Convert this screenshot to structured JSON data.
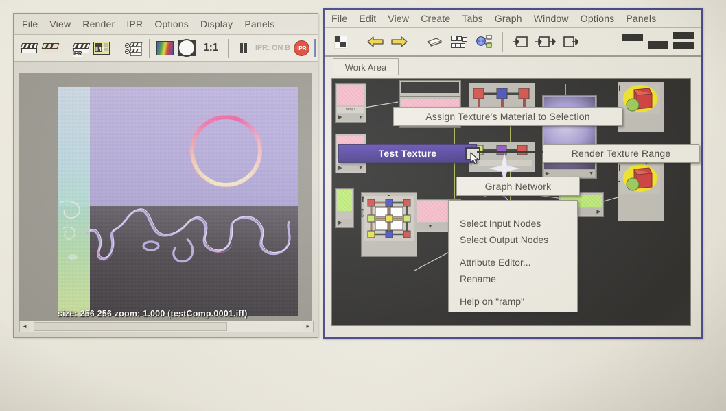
{
  "render_window": {
    "menus": [
      "File",
      "View",
      "Render",
      "IPR",
      "Options",
      "Display",
      "Panels"
    ],
    "toolbar": [
      {
        "name": "render-clapper-icon",
        "label": ""
      },
      {
        "name": "render-region-clapper-icon",
        "label": ""
      },
      {
        "name": "ipr-clapper-icon",
        "label": "IPR"
      },
      {
        "name": "ipr-box-icon",
        "label": "IPR"
      },
      {
        "name": "ipr-options-icon",
        "label": ""
      },
      {
        "name": "color-channel-icon",
        "label": ""
      },
      {
        "name": "alpha-channel-icon",
        "label": ""
      },
      {
        "name": "zoom-one-to-one-button",
        "label": "1:1"
      },
      {
        "name": "pause-ipr-icon",
        "label": ""
      },
      {
        "name": "ipr-status-label",
        "label": "IPR: ON B"
      },
      {
        "name": "stop-ipr-icon",
        "label": "IPR"
      }
    ],
    "status": {
      "text": "size:  256  256 zoom: 1.000   (testComp.0001.iff)",
      "size_label": "size:",
      "width": "256",
      "height": "256",
      "zoom_label": "zoom:",
      "zoom_value": "1.000",
      "file": "(testComp.0001.iff)"
    },
    "scrollbar": {
      "left_arrow": "◄",
      "right_arrow": "►"
    }
  },
  "hypershade_window": {
    "menus": [
      "File",
      "Edit",
      "View",
      "Create",
      "Tabs",
      "Graph",
      "Window",
      "Options",
      "Panels"
    ],
    "toolbar": [
      {
        "name": "checker-swatch-icon"
      },
      {
        "name": "back-arrow-icon"
      },
      {
        "name": "forward-arrow-icon"
      },
      {
        "name": "clear-graph-icon"
      },
      {
        "name": "rearrange-graph-icon"
      },
      {
        "name": "show-network-icon"
      },
      {
        "name": "input-connections-icon"
      },
      {
        "name": "input-output-connections-icon"
      },
      {
        "name": "output-connections-icon"
      }
    ],
    "tabs": [
      {
        "label": "Work Area",
        "active": true
      }
    ],
    "graph": {
      "node_caption": "ramp1",
      "nodes": [
        {
          "name": "ramp-node",
          "kind": "pink"
        },
        {
          "name": "ramp-node",
          "kind": "pink"
        },
        {
          "name": "ramp-node",
          "kind": "pink"
        },
        {
          "name": "ramp-node",
          "kind": "green"
        },
        {
          "name": "shading-group-node",
          "kind": "shaderball"
        },
        {
          "name": "place2d-texture-node",
          "kind": "placement"
        }
      ]
    }
  },
  "context_menus": {
    "assign_texture": "Assign Texture's Material to Selection",
    "render_texture_range": "Render Texture Range",
    "test_texture": "Test Texture",
    "graph_network": "Graph Network",
    "node_menu": [
      "Select Input Nodes",
      "Select Output Nodes",
      "Attribute Editor...",
      "Rename",
      "Help on \"ramp\""
    ]
  },
  "colors": {
    "highlight": "#35238b",
    "window_border": "#2a2a7e",
    "panel_bg": "#e9e7dd",
    "graph_bg": "#0d0d0d",
    "node_pink": "#f2a8bc",
    "node_green": "#a9e25a",
    "shader_yellow": "#f5e409",
    "shader_red": "#cc2020",
    "shader_green": "#8ec63f",
    "stop_red": "#e02a18"
  }
}
